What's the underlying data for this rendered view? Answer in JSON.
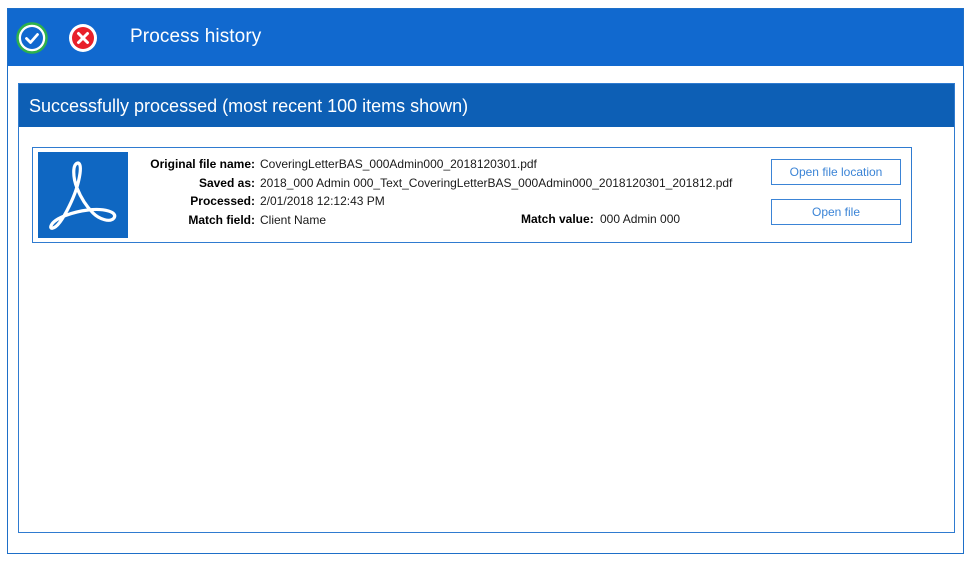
{
  "window": {
    "title": "Process history",
    "accent_color": "#1169cf",
    "ok_icon": "check-circle-icon",
    "cancel_icon": "close-x-icon"
  },
  "section": {
    "title": "Successfully processed (most recent 100 items shown)",
    "header_color": "#0d5fb5"
  },
  "items": [
    {
      "icon": "pdf-acrobat-icon",
      "labels": {
        "original": "Original file name:",
        "saved": "Saved as:",
        "processed": "Processed:",
        "match_field": "Match field:",
        "match_value": "Match value:"
      },
      "original_file_name": "CoveringLetterBAS_000Admin000_2018120301.pdf",
      "saved_as": "2018_000 Admin 000_Text_CoveringLetterBAS_000Admin000_2018120301_201812.pdf",
      "processed": "2/01/2018 12:12:43 PM",
      "match_field": "Client Name",
      "match_value": "000 Admin 000",
      "buttons": {
        "open_location": "Open file location",
        "open_file": "Open file"
      }
    }
  ]
}
